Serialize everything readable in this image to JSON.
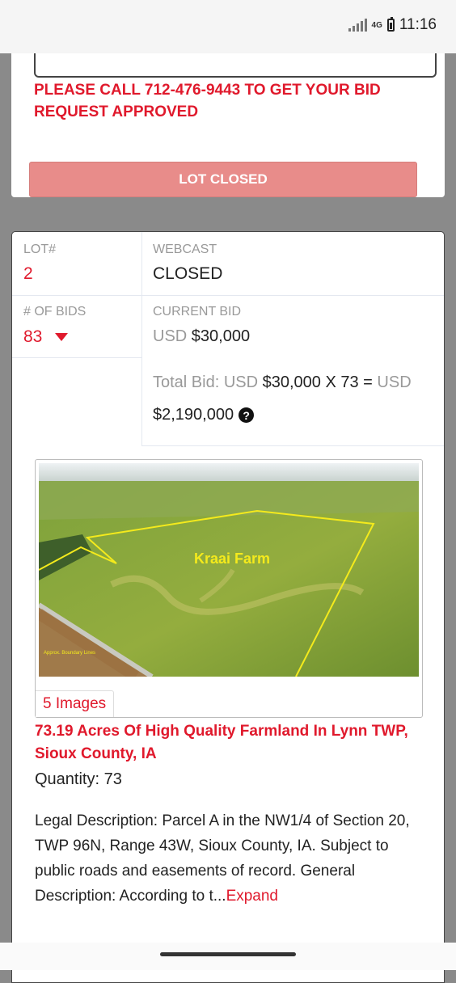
{
  "status_bar": {
    "network": "4G",
    "time": "11:16"
  },
  "previous_lot": {
    "warning": "PLEASE CALL 712-476-9443 TO GET YOUR BID REQUEST APPROVED",
    "button_label": "LOT CLOSED"
  },
  "lot": {
    "lot_label": "LOT#",
    "lot_number": "2",
    "webcast_label": "WEBCAST",
    "webcast_status": "CLOSED",
    "bids_label": "# OF BIDS",
    "bids_count": "83",
    "current_bid_label": "CURRENT BID",
    "currency": "USD",
    "current_bid": "$30,000",
    "total_bid_label": "Total Bid:",
    "total_bid_expr": "$30,000 X 73 =",
    "total_bid_value": "$2,190,000",
    "image_overlay_text": "Kraai Farm",
    "image_caption": "Approx. Boundary Lines",
    "images_count": "5 Images",
    "title": "73.19 Acres Of High Quality Farmland In Lynn TWP, Sioux County, IA",
    "quantity": "Quantity: 73",
    "description": "Legal Description: Parcel A in the NW1/4 of Section 20, TWP 96N, Range 43W, Sioux County, IA. Subject to public roads and easements of record.   General Description: According to t...",
    "expand_label": "Expand"
  },
  "colors": {
    "accent": "#e0192c",
    "disabled_button": "#e88c8a",
    "label": "#999999"
  },
  "icons": [
    "signal-icon",
    "battery-icon",
    "caret-down-icon",
    "help-circle-icon"
  ]
}
